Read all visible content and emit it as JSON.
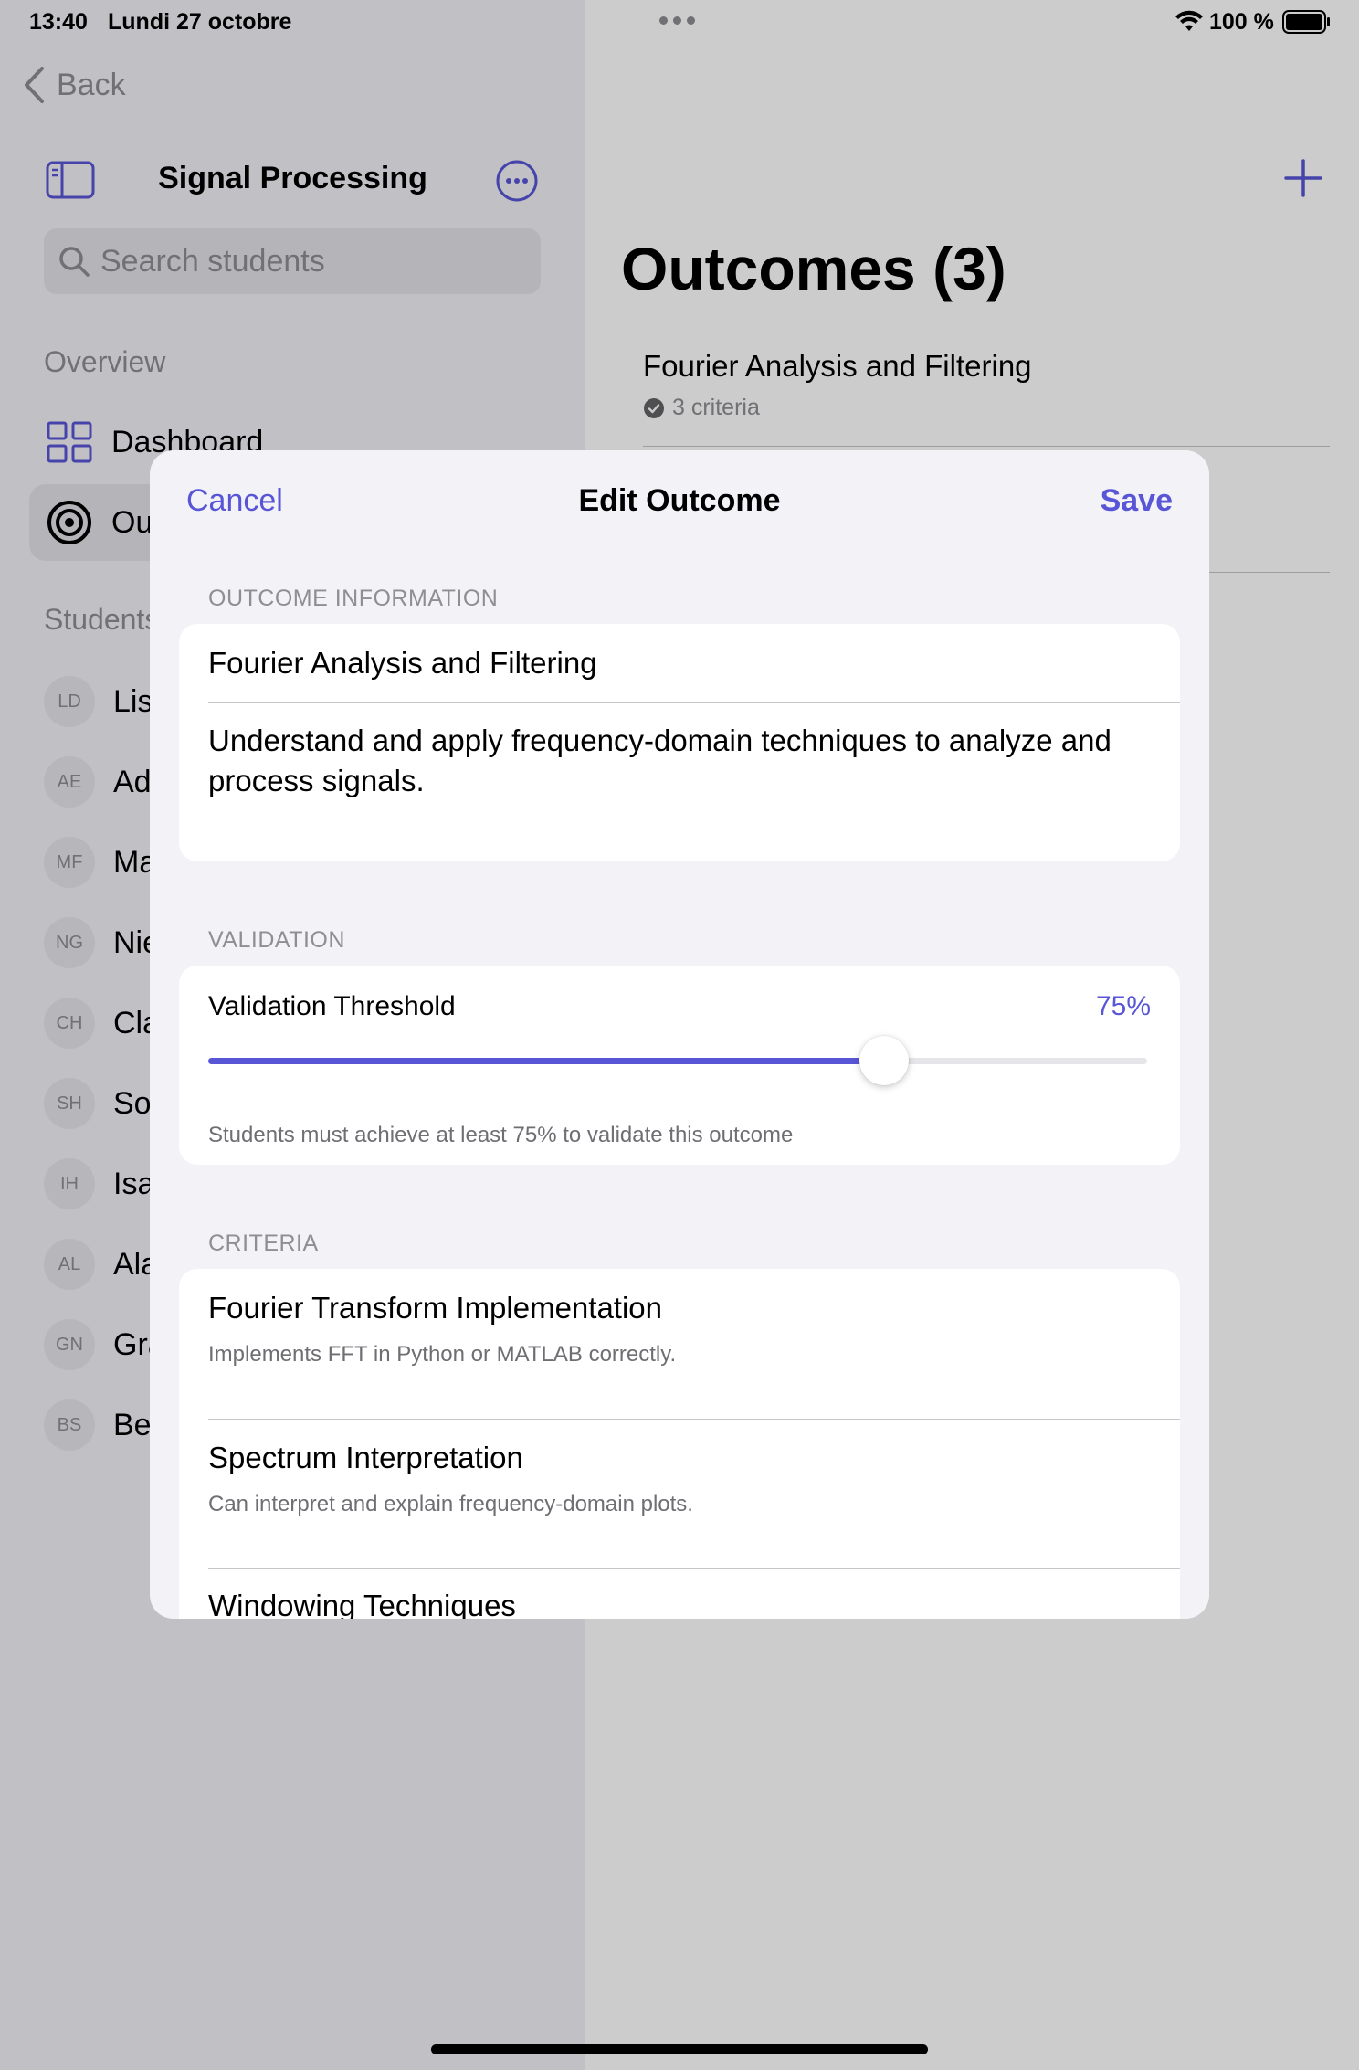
{
  "status_bar": {
    "time": "13:40",
    "date": "Lundi 27 octobre",
    "battery": "100 %"
  },
  "sidebar": {
    "back_label": "Back",
    "title": "Signal Processing",
    "search_placeholder": "Search students",
    "overview_label": "Overview",
    "nav": [
      {
        "label": "Dashboard",
        "icon": "grid-icon"
      },
      {
        "label": "Outcomes",
        "icon": "target-icon"
      }
    ],
    "students_label": "Students",
    "students": [
      {
        "initials": "LD",
        "name": "Lis"
      },
      {
        "initials": "AE",
        "name": "Ad"
      },
      {
        "initials": "MF",
        "name": "Ma"
      },
      {
        "initials": "NG",
        "name": "Nie"
      },
      {
        "initials": "CH",
        "name": "Cla"
      },
      {
        "initials": "SH",
        "name": "So"
      },
      {
        "initials": "IH",
        "name": "Isa"
      },
      {
        "initials": "AL",
        "name": "Ala"
      },
      {
        "initials": "GN",
        "name": "Gra"
      },
      {
        "initials": "BS",
        "name": "Be"
      }
    ]
  },
  "detail": {
    "title": "Outcomes (3)",
    "outcomes": [
      {
        "name": "Fourier Analysis and Filtering",
        "criteria": "3 criteria"
      }
    ]
  },
  "modal": {
    "cancel_label": "Cancel",
    "title": "Edit Outcome",
    "save_label": "Save",
    "info_section": "OUTCOME INFORMATION",
    "outcome_title": "Fourier Analysis and Filtering",
    "outcome_description": "Understand and apply frequency-domain techniques to analyze and process signals.",
    "validation_section": "VALIDATION",
    "threshold_label": "Validation Threshold",
    "threshold_value": "75%",
    "threshold_fraction": 0.72,
    "threshold_hint": "Students must achieve at least 75% to validate this outcome",
    "criteria_section": "CRITERIA",
    "criteria": [
      {
        "name": "Fourier Transform Implementation",
        "description": "Implements FFT in Python or MATLAB correctly."
      },
      {
        "name": "Spectrum Interpretation",
        "description": "Can interpret and explain frequency-domain plots."
      },
      {
        "name": "Windowing Techniques",
        "description": ""
      }
    ]
  },
  "colors": {
    "accent": "#5856d6",
    "secondary_text": "#8e8e93"
  }
}
